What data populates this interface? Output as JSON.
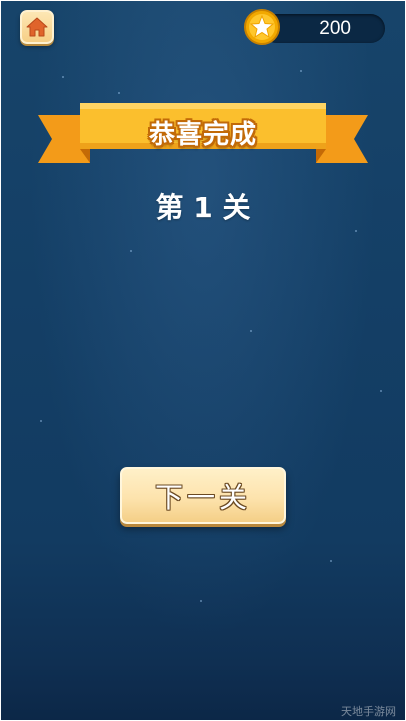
{
  "header": {
    "home_icon": "home-icon",
    "coin_icon": "star-coin-icon",
    "coins": "200"
  },
  "banner": {
    "title": "恭喜完成"
  },
  "level": {
    "text": "第 1 关"
  },
  "actions": {
    "next_label": "下一关"
  },
  "watermark": "天地手游网",
  "colors": {
    "background": "#143f66",
    "ribbon": "#f8b52b",
    "button": "#fde3ad",
    "coin": "#f7b500"
  }
}
